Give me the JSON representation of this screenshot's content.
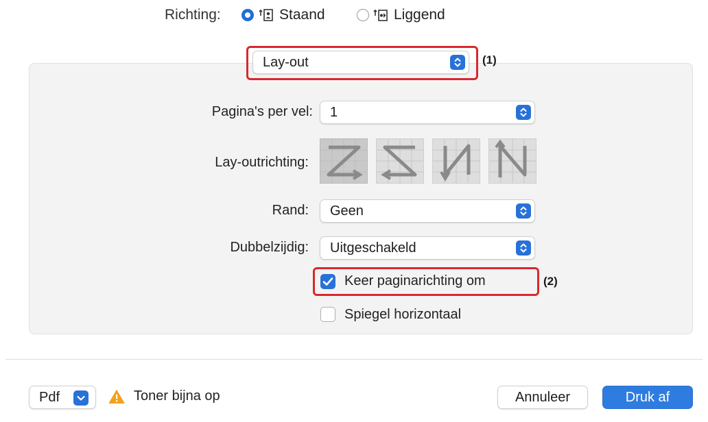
{
  "orientation": {
    "label": "Richting:",
    "options": [
      {
        "label": "Staand",
        "selected": true
      },
      {
        "label": "Liggend",
        "selected": false
      }
    ]
  },
  "section_select": {
    "value": "Lay-out",
    "callout": "(1)"
  },
  "layout": {
    "pages_per_sheet": {
      "label": "Pagina's per vel:",
      "value": "1"
    },
    "layout_direction": {
      "label": "Lay-outrichting:",
      "options": [
        "Z-icon",
        "reverse-Z-icon",
        "reverse-N-icon",
        "N-icon"
      ],
      "selected_index": 0
    },
    "border": {
      "label": "Rand:",
      "value": "Geen"
    },
    "two_sided": {
      "label": "Dubbelzijdig:",
      "value": "Uitgeschakeld"
    },
    "reverse_orientation": {
      "label": "Keer paginarichting om",
      "checked": true,
      "callout": "(2)"
    },
    "flip_horizontal": {
      "label": "Spiegel horizontaal",
      "checked": false
    }
  },
  "footer": {
    "pdf_label": "Pdf",
    "warning_text": "Toner bijna op",
    "cancel_label": "Annuleer",
    "print_label": "Druk af"
  },
  "colors": {
    "accent": "#2871d8",
    "highlight": "#d8282e",
    "warning": "#f2a21a"
  }
}
